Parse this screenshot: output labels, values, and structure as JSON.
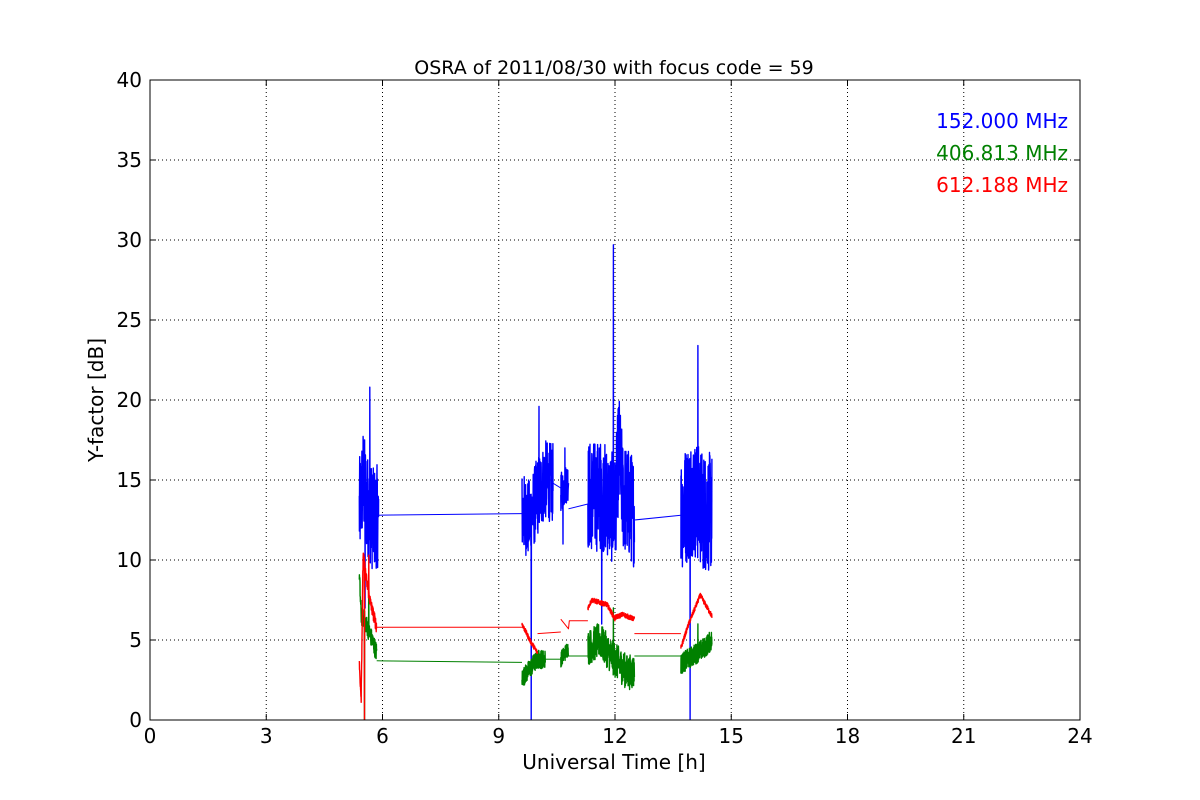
{
  "chart_data": {
    "type": "line",
    "title": "OSRA of 2011/08/30 with focus code = 59",
    "xlabel": "Universal Time [h]",
    "ylabel": "Y-factor [dB]",
    "xlim": [
      0,
      24
    ],
    "ylim": [
      0,
      40
    ],
    "xticks": [
      0,
      3,
      6,
      9,
      12,
      15,
      18,
      21,
      24
    ],
    "yticks": [
      0,
      5,
      10,
      15,
      20,
      25,
      30,
      35,
      40
    ],
    "grid": true,
    "legend_position": "top-right",
    "series": [
      {
        "name": "152.000 MHz",
        "color": "#0000ff",
        "segments": [
          {
            "x": [
              5.4,
              5.5,
              5.6,
              5.75,
              5.9
            ],
            "y": [
              13.0,
              15.0,
              13.5,
              12.5,
              12.8
            ],
            "noise": 6.5,
            "max": 20.8,
            "min": 7.0
          },
          {
            "x": [
              5.9,
              9.6
            ],
            "y": [
              12.8,
              12.9
            ]
          },
          {
            "x": [
              9.6,
              9.8,
              10.0,
              10.2,
              10.4
            ],
            "y": [
              13.0,
              12.5,
              14.0,
              15.0,
              14.8
            ],
            "noise": 5.0,
            "max": 19.6,
            "min": 0.0
          },
          {
            "x": [
              10.4,
              10.6
            ],
            "y": [
              14.8,
              14.5
            ]
          },
          {
            "x": [
              10.6,
              10.8
            ],
            "y": [
              14.2,
              15.0
            ],
            "noise": 2.5,
            "max": 17.0,
            "min": 11.0
          },
          {
            "x": [
              10.8,
              11.3
            ],
            "y": [
              13.2,
              13.5
            ]
          },
          {
            "x": [
              11.3,
              11.7,
              12.0,
              12.1,
              12.2,
              12.5
            ],
            "y": [
              14.0,
              14.0,
              13.0,
              17.0,
              14.0,
              13.0
            ],
            "noise": 7.0,
            "max": 29.7,
            "min": 6.0
          },
          {
            "x": [
              12.5,
              13.7
            ],
            "y": [
              12.5,
              12.8
            ]
          },
          {
            "x": [
              13.7,
              14.0,
              14.3,
              14.5
            ],
            "y": [
              13.0,
              14.0,
              13.0,
              13.0
            ],
            "noise": 7.5,
            "max": 23.4,
            "min": 0.0
          }
        ]
      },
      {
        "name": "406.813 MHz",
        "color": "#008000",
        "segments": [
          {
            "x": [
              5.4,
              5.45,
              5.55,
              5.7,
              5.85
            ],
            "y": [
              9.2,
              6.5,
              6.2,
              5.2,
              4.2
            ],
            "noise": 1.2,
            "max": 9.2,
            "min": 0.0
          },
          {
            "x": [
              5.85,
              9.6
            ],
            "y": [
              3.7,
              3.6
            ]
          },
          {
            "x": [
              9.6,
              9.8,
              10.0,
              10.2
            ],
            "y": [
              2.6,
              3.2,
              3.8,
              3.8
            ],
            "noise": 1.2
          },
          {
            "x": [
              10.2,
              10.6
            ],
            "y": [
              3.8,
              3.8
            ]
          },
          {
            "x": [
              10.6,
              10.8
            ],
            "y": [
              3.8,
              4.5
            ],
            "noise": 1.0
          },
          {
            "x": [
              10.8,
              11.3
            ],
            "y": [
              4.0,
              4.0
            ]
          },
          {
            "x": [
              11.3,
              11.6,
              11.9,
              12.3,
              12.5
            ],
            "y": [
              4.5,
              5.0,
              4.0,
              3.0,
              3.0
            ],
            "noise": 2.2,
            "max": 7.0
          },
          {
            "x": [
              12.5,
              13.7
            ],
            "y": [
              4.0,
              4.0
            ]
          },
          {
            "x": [
              13.7,
              14.0,
              14.3,
              14.5
            ],
            "y": [
              3.5,
              4.0,
              4.5,
              5.0
            ],
            "noise": 1.3,
            "max": 6.0
          }
        ]
      },
      {
        "name": "612.188 MHz",
        "color": "#ff0000",
        "segments": [
          {
            "x": [
              5.4,
              5.45,
              5.5,
              5.6,
              5.7,
              5.85
            ],
            "y": [
              3.5,
              1.5,
              10.3,
              8.5,
              7.2,
              5.8
            ],
            "noise": 0.8,
            "max": 10.3,
            "min": 0.0
          },
          {
            "x": [
              5.85,
              9.6
            ],
            "y": [
              5.8,
              5.8
            ]
          },
          {
            "x": [
              9.6,
              9.8,
              10.0
            ],
            "y": [
              6.0,
              5.0,
              4.2
            ],
            "noise": 0.3
          },
          {
            "x": [
              10.0,
              10.6
            ],
            "y": [
              5.4,
              5.5
            ]
          },
          {
            "x": [
              10.6,
              10.8,
              10.82,
              11.3
            ],
            "y": [
              6.3,
              5.7,
              6.2,
              6.2
            ]
          },
          {
            "x": [
              11.3,
              11.4,
              11.8,
              12.0
            ],
            "y": [
              7.0,
              7.5,
              7.2,
              6.3
            ],
            "noise": 0.3
          },
          {
            "x": [
              12.0,
              12.2,
              12.5
            ],
            "y": [
              6.4,
              6.6,
              6.3
            ],
            "noise": 0.3
          },
          {
            "x": [
              12.5,
              13.7
            ],
            "y": [
              5.4,
              5.4
            ]
          },
          {
            "x": [
              13.7,
              13.9,
              14.2,
              14.5
            ],
            "y": [
              4.5,
              6.0,
              7.8,
              6.5
            ],
            "noise": 0.3
          }
        ]
      }
    ]
  }
}
